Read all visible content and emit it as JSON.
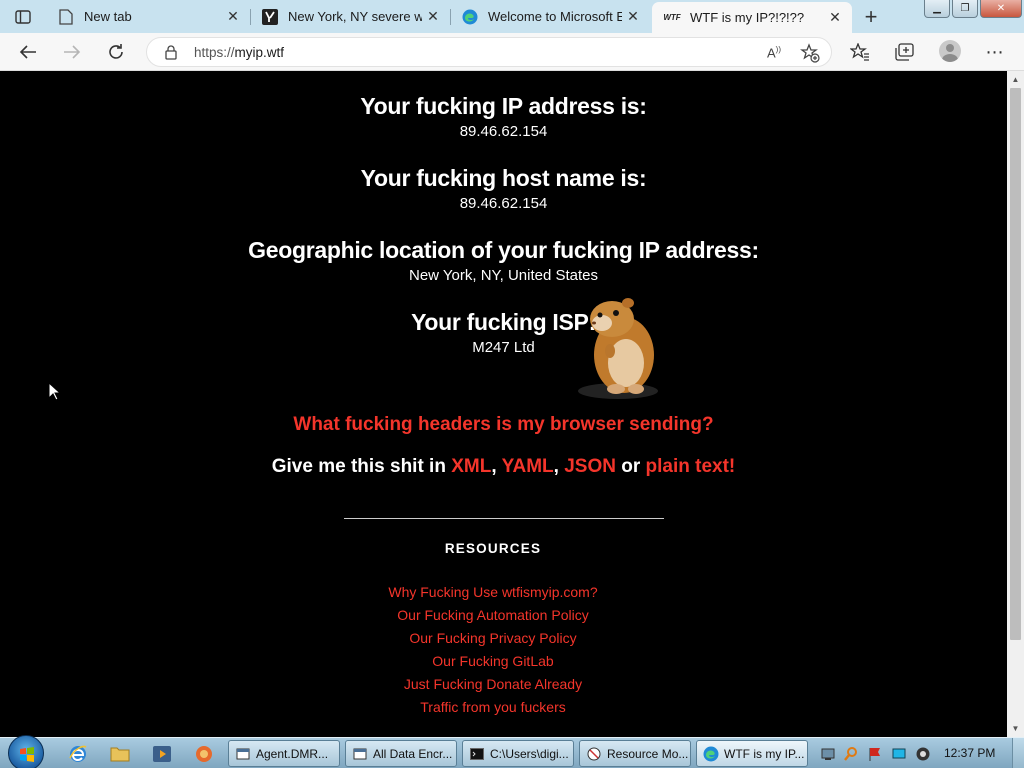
{
  "browser": {
    "tabs": [
      {
        "title": "New tab",
        "icon": "newtab-icon"
      },
      {
        "title": "New York, NY severe wea",
        "icon": "yahoo-icon"
      },
      {
        "title": "Welcome to Microsoft Ed",
        "icon": "edge-icon"
      },
      {
        "title": "WTF is my IP?!?!??",
        "icon": "wtf-icon",
        "active": true
      }
    ],
    "url_scheme": "https://",
    "url_host": "myip.wtf",
    "wtf_favicon_text": "WTF"
  },
  "page": {
    "ip_heading": "Your fucking IP address is:",
    "ip_value": "89.46.62.154",
    "host_heading": "Your fucking host name is:",
    "host_value": "89.46.62.154",
    "geo_heading": "Geographic location of your fucking IP address:",
    "geo_value": "New York, NY, United States",
    "isp_heading": "Your fucking ISP:",
    "isp_value": "M247 Ltd",
    "headers_link": "What fucking headers is my browser sending?",
    "formats_prefix": "Give me this shit in ",
    "formats": {
      "xml": "XML",
      "sep1": ", ",
      "yaml": "YAML",
      "sep2": ", ",
      "json": "JSON",
      "or": " or ",
      "plain": "plain text!"
    },
    "resources_title": "RESOURCES",
    "resources": [
      "Why Fucking Use wtfismyip.com?",
      "Our Fucking Automation Policy",
      "Our Fucking Privacy Policy",
      "Our Fucking GitLab",
      "Just Fucking Donate Already",
      "Traffic from you fuckers"
    ]
  },
  "taskbar": {
    "tasks": [
      {
        "label": "Agent.DMR...",
        "icon": "window-icon"
      },
      {
        "label": "All Data Encr...",
        "icon": "window-icon"
      },
      {
        "label": "C:\\Users\\digi...",
        "icon": "cmd-icon"
      },
      {
        "label": "Resource Mo...",
        "icon": "monitor-icon"
      },
      {
        "label": "WTF is my IP...",
        "icon": "edge-icon",
        "active": true
      }
    ],
    "clock": "12:37 PM"
  },
  "colors": {
    "link_red": "#f4352b",
    "tabstrip": "#c8e2ef",
    "page_bg": "#000000"
  }
}
